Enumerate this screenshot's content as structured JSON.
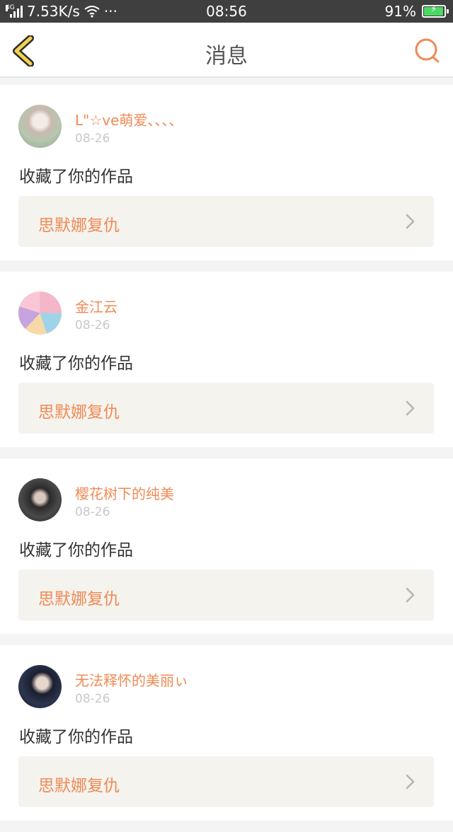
{
  "status_bar": {
    "network_type": "4G",
    "speed": "7.53K/s",
    "more": "···",
    "time": "08:56",
    "battery": "91%"
  },
  "header": {
    "title": "消息",
    "back_icon": "back-chevron-icon",
    "search_icon": "search-icon",
    "accent_color": "#f08a55"
  },
  "messages": [
    {
      "user": "L\"☆ve萌爱、、、、",
      "date": "08-26",
      "action": "收藏了你的作品",
      "work_title": "思默娜复仇"
    },
    {
      "user": "金江云",
      "date": "08-26",
      "action": "收藏了你的作品",
      "work_title": "思默娜复仇"
    },
    {
      "user": "樱花树下的纯美",
      "date": "08-26",
      "action": "收藏了你的作品",
      "work_title": "思默娜复仇"
    },
    {
      "user": "无法释怀的美丽ぃ",
      "date": "08-26",
      "action": "收藏了你的作品",
      "work_title": "思默娜复仇"
    }
  ]
}
